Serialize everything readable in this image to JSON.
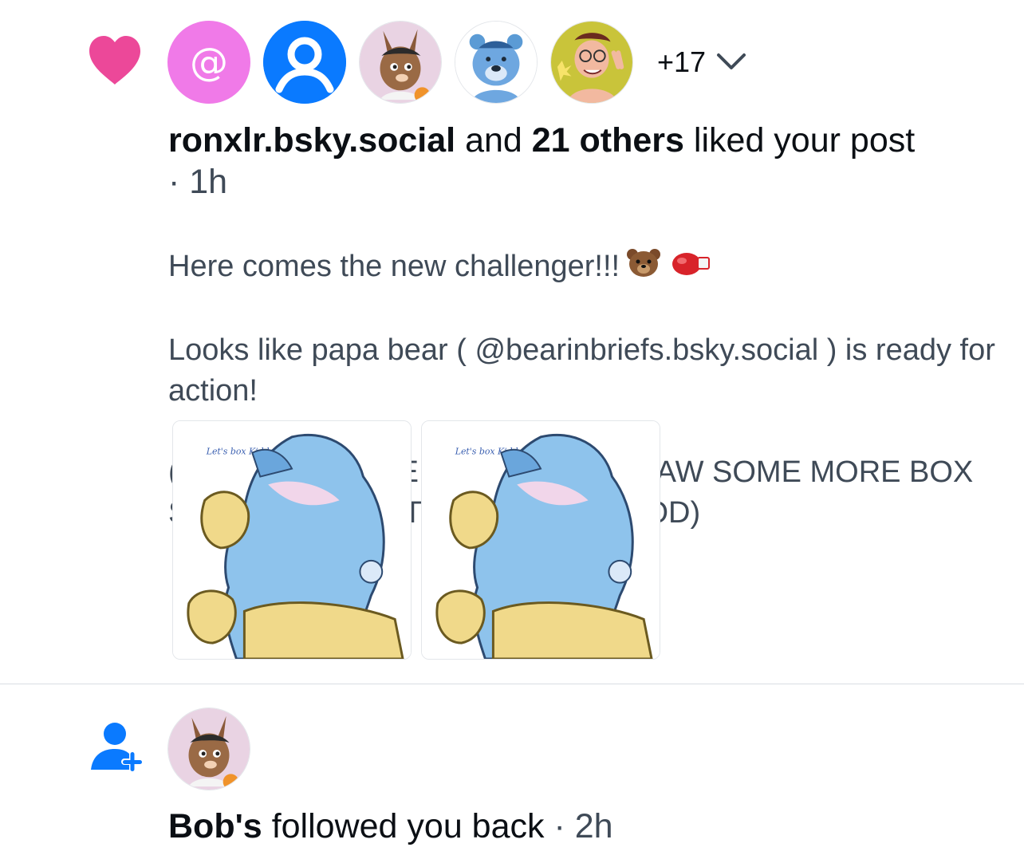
{
  "like_notification": {
    "additional_count_label": "+17",
    "actor": "ronxlr.bsky.social",
    "joiner": "and",
    "others": "21 others",
    "action": "liked your post",
    "time": "· 1h",
    "post": {
      "line1": "Here comes the new challenger!!!",
      "line2": "Looks like papa bear ( @bearinbriefs.bsky.social ) is ready for action!",
      "line3": "(YEAH I HAD THE ENERGY TO DRAW SOME MORE BOX STUFF, I THINK IT CAME OUT GOOD)"
    },
    "image_caption": "Let's box Kiddo!",
    "colors": {
      "heart": "#ec4899",
      "at_avatar": "#f07ae8",
      "default_avatar": "#0a7aff"
    }
  },
  "follow_notification": {
    "actor": "Bob's",
    "action": "followed you back",
    "time": "· 2h",
    "icon_color": "#0a7aff"
  }
}
